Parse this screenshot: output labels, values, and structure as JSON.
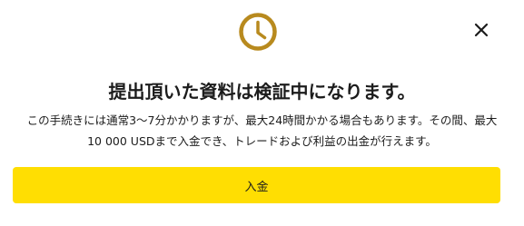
{
  "icons": {
    "status": "clock-icon",
    "close": "close-icon",
    "accent_color": "#b88a1e"
  },
  "dialog": {
    "title": "提出頂いた資料は検証中になります。",
    "description_line1": "この手続きには通常3～7分かかりますが、最大24時間かかる場合もあります。その間、最大",
    "description_line2": "10 000 USDまで入金でき、トレードおよび利益の出金が行えます。",
    "deposit_button_label": "入金",
    "button_color": "#ffde02"
  }
}
